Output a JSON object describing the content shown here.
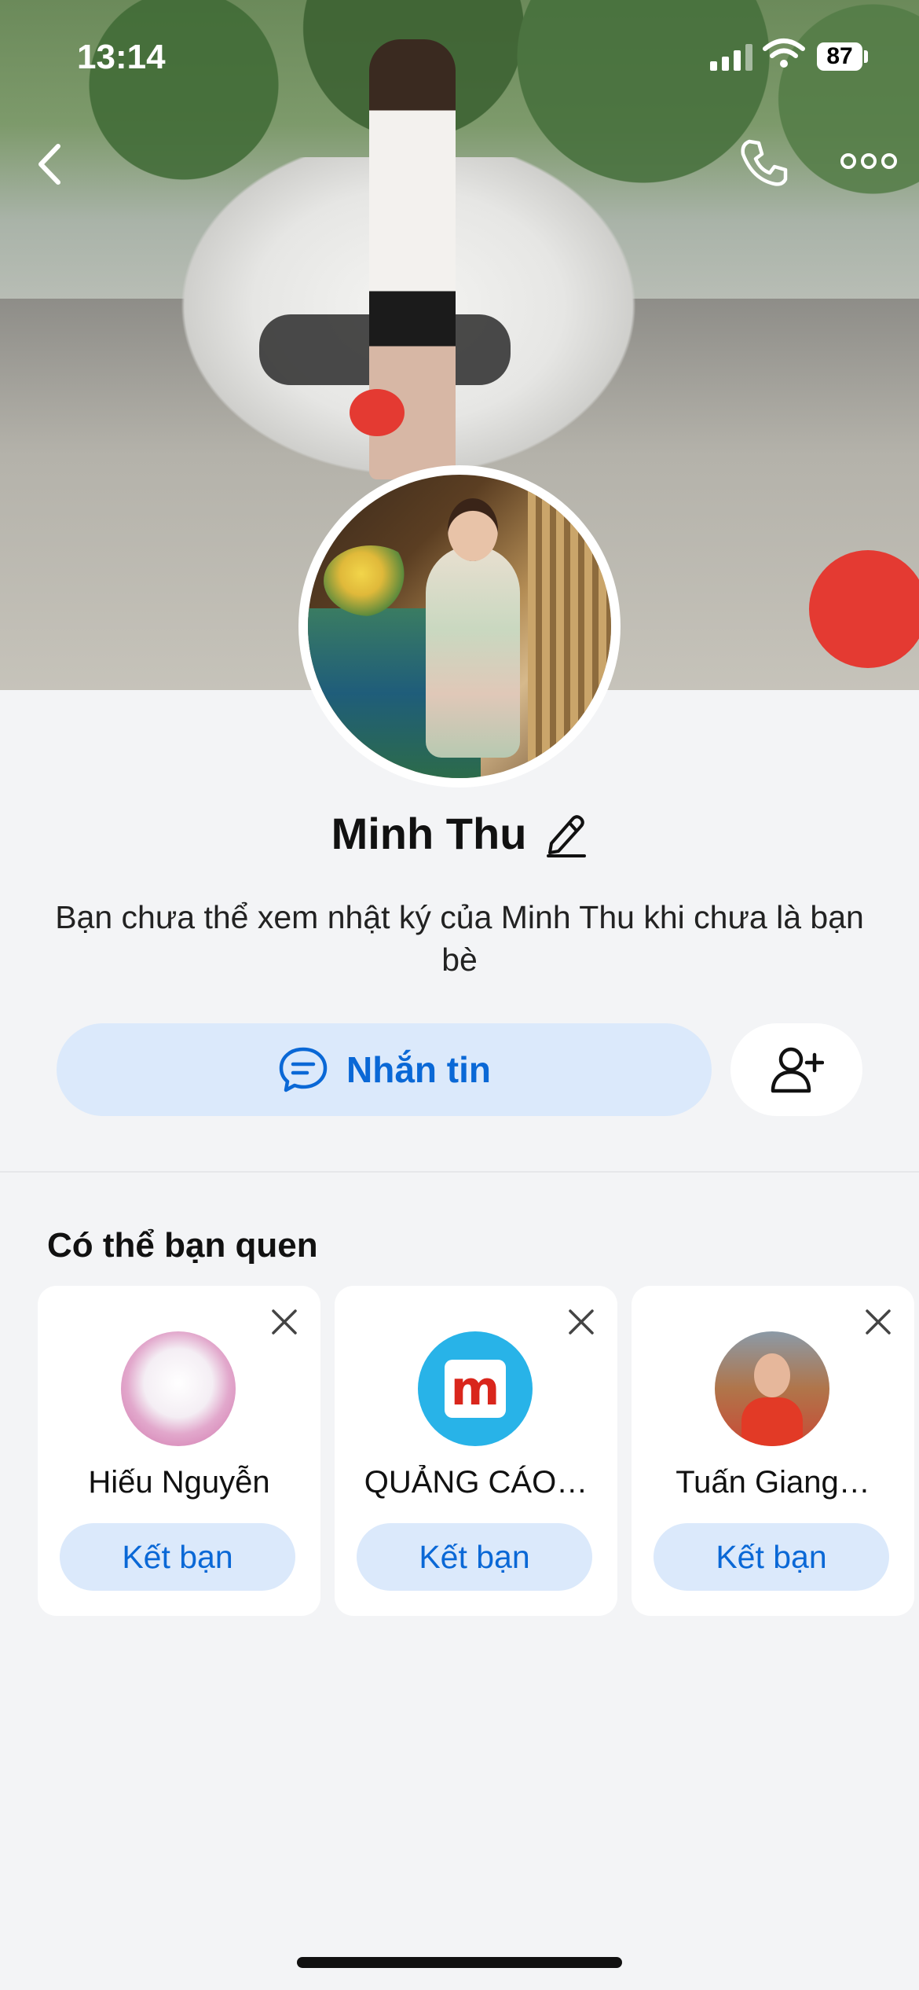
{
  "status_bar": {
    "time": "13:14",
    "battery": "87"
  },
  "profile": {
    "name": "Minh Thu",
    "description": "Bạn chưa thể xem nhật ký của Minh Thu khi chưa là bạn bè"
  },
  "actions": {
    "message_label": "Nhắn tin"
  },
  "suggestions": {
    "title": "Có thể bạn quen",
    "items": [
      {
        "name": "Hiếu Nguyễn",
        "button": "Kết bạn"
      },
      {
        "name": "QUẢNG CÁO…",
        "button": "Kết bạn"
      },
      {
        "name": "Tuấn Giang…",
        "button": "Kết bạn"
      }
    ]
  },
  "colors": {
    "accent": "#0a68d6",
    "accent_bg": "#dbe9fb",
    "background": "#f3f4f6"
  }
}
